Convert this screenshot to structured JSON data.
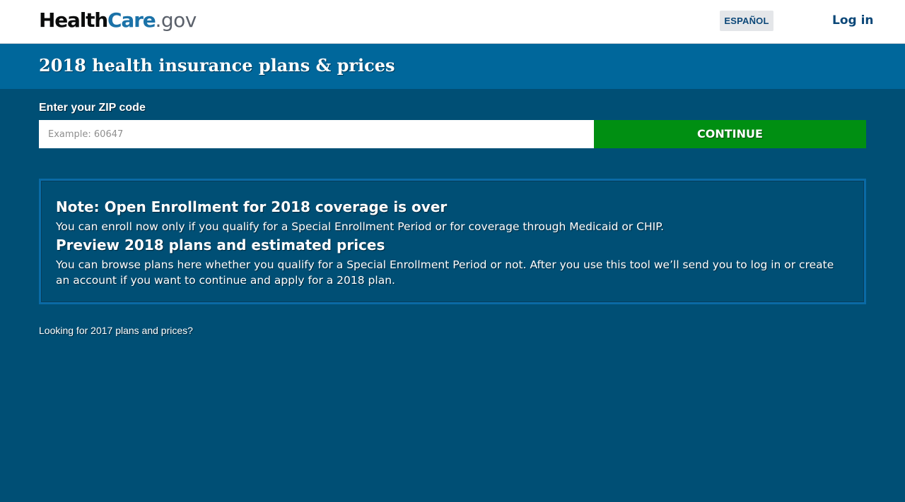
{
  "header": {
    "logo": {
      "part1": "Health",
      "part2": "Care",
      "part3": ".gov"
    },
    "language_button": "ESPAÑOL",
    "login_link": "Log in"
  },
  "title_band": {
    "title": "2018 health insurance plans & prices"
  },
  "zip_form": {
    "label": "Enter your ZIP code",
    "input_value": "",
    "placeholder": "Example: 60647",
    "continue_button": "CONTINUE"
  },
  "note": {
    "heading1": "Note: Open Enrollment for 2018 coverage is over",
    "text1": "You can enroll now only if you qualify for a Special Enrollment Period or for coverage through Medicaid or CHIP.",
    "heading2": "Preview 2018 plans and estimated prices",
    "text2": "You can browse plans here whether you qualify for a Special Enrollment Period or not. After you use this tool we’ll send you to log in or create an account if you want to continue and apply for a 2018 plan."
  },
  "previous_year_link": "Looking for 2017 plans and prices?",
  "colors": {
    "page_background": "#004f75",
    "title_band": "#00679b",
    "continue_button": "#008f12",
    "brand_dark": "#0b4778",
    "note_border": "#0a6aa5"
  }
}
